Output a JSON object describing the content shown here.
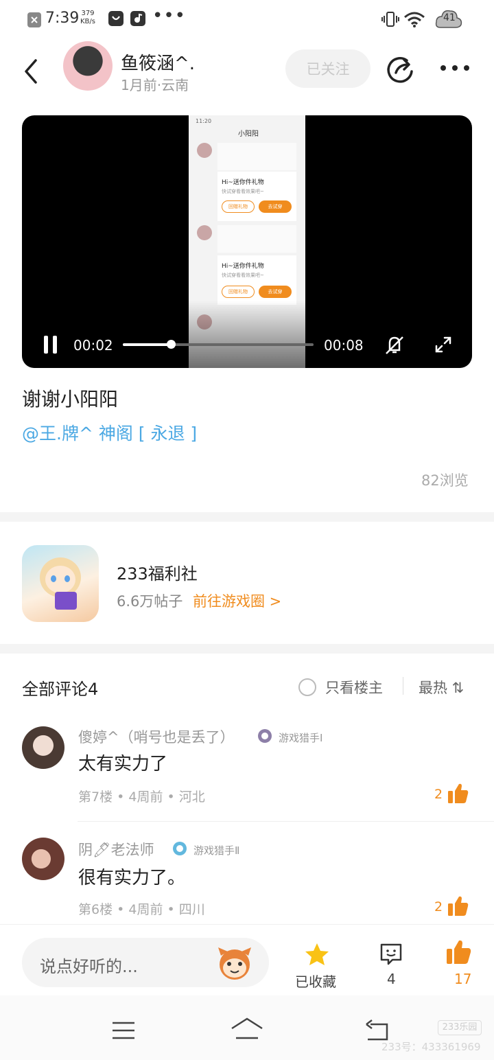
{
  "status_bar": {
    "time": "7:39",
    "speed_value": "379",
    "speed_unit": "KB/s",
    "overflow": "•••",
    "battery": "41"
  },
  "header": {
    "username": "鱼筱涵^.",
    "meta": "1月前·云南",
    "follow_label": "已关注"
  },
  "video": {
    "current_time": "00:02",
    "total_time": "00:08",
    "progress": 0.25,
    "inner": {
      "time": "11:20",
      "title": "小阳阳",
      "card_title": "Hi~送你件礼物",
      "card_sub": "快试穿看看效果吧~",
      "btn_return": "回赠礼物",
      "btn_try": "去试穿"
    }
  },
  "post": {
    "title": "谢谢小阳阳",
    "tags": "@王.牌^ 神阁 [ 永退 ]",
    "views": "82浏览"
  },
  "game_circle": {
    "name": "233福利社",
    "posts": "6.6万帖子",
    "link": "前往游戏圈 >"
  },
  "comments_header": {
    "title": "全部评论4",
    "only_owner": "只看楼主",
    "sort": "最热 ⇅"
  },
  "comments": [
    {
      "name": "傻婷^（哨号也是丢了）",
      "badge": "游戏猎手Ⅰ",
      "text": "太有实力了",
      "meta": "第7楼 • 4周前 • 河北",
      "likes": "2"
    },
    {
      "name": "阴🖊老法师",
      "badge": "游戏猎手Ⅱ",
      "text": "很有实力了。",
      "meta": "第6楼 • 4周前 • 四川",
      "likes": "2"
    }
  ],
  "bottom_bar": {
    "placeholder": "说点好听的...",
    "collect_label": "已收藏",
    "comment_count": "4",
    "like_count": "17"
  },
  "watermark": {
    "logo": "233乐园",
    "id": "233号：433361969"
  },
  "colors": {
    "accent": "#f08c1e",
    "link": "#4ba8e3",
    "star": "#f9c215"
  }
}
